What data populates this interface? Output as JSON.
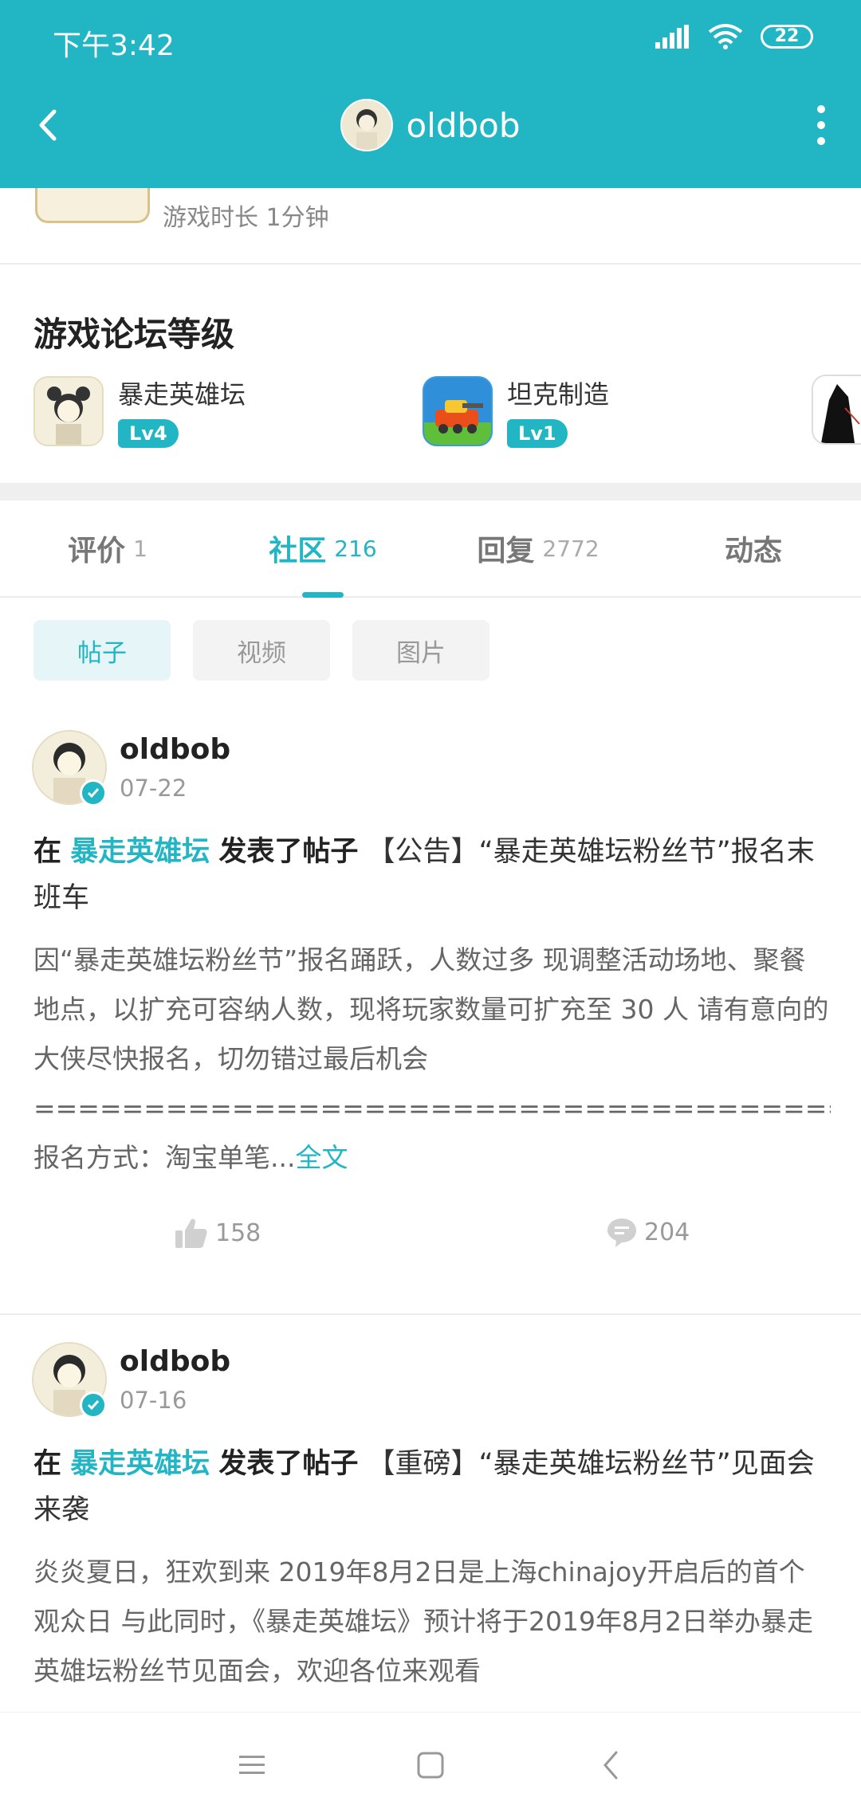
{
  "status_bar": {
    "time": "下午3:42",
    "battery": "22"
  },
  "header": {
    "title": "oldbob"
  },
  "game_time": {
    "text": "游戏时长 1分钟"
  },
  "forum_level": {
    "title": "游戏论坛等级",
    "items": [
      {
        "name": "暴走英雄坛",
        "level": "Lv4"
      },
      {
        "name": "坦克制造",
        "level": "Lv1"
      }
    ]
  },
  "tabs": [
    {
      "label": "评价",
      "count": "1"
    },
    {
      "label": "社区",
      "count": "216"
    },
    {
      "label": "回复",
      "count": "2772"
    },
    {
      "label": "动态",
      "count": ""
    }
  ],
  "filter_chips": [
    {
      "label": "帖子"
    },
    {
      "label": "视频"
    },
    {
      "label": "图片"
    }
  ],
  "posts": [
    {
      "user": "oldbob",
      "date": "07-22",
      "title_prefix": "在",
      "forum": "暴走英雄坛",
      "title_action": "发表了帖子",
      "title": "【公告】“暴走英雄坛粉丝节”报名末班车",
      "body": "因“暴走英雄坛粉丝节”报名踊跃，人数过多 现调整活动场地、聚餐地点，以扩充可容纳人数，现将玩家数量可扩充至  30  人 请有意向的大侠尽快报名，切勿错过最后机会 ================================================================== 报名方式：淘宝单笔...",
      "more": "全文",
      "likes": "158",
      "comments": "204"
    },
    {
      "user": "oldbob",
      "date": "07-16",
      "title_prefix": "在",
      "forum": "暴走英雄坛",
      "title_action": "发表了帖子",
      "title": "【重磅】“暴走英雄坛粉丝节”见面会来袭",
      "body": "炎炎夏日，狂欢到来 2019年8月2日是上海chinajoy开启后的首个观众日 与此同时，《暴走英雄坛》预计将于2019年8月2日举办暴走英雄坛粉丝节见面会，欢迎各位来观看"
    }
  ],
  "colors": {
    "accent": "#22b5c4",
    "text": "#222222",
    "muted": "#999999"
  }
}
